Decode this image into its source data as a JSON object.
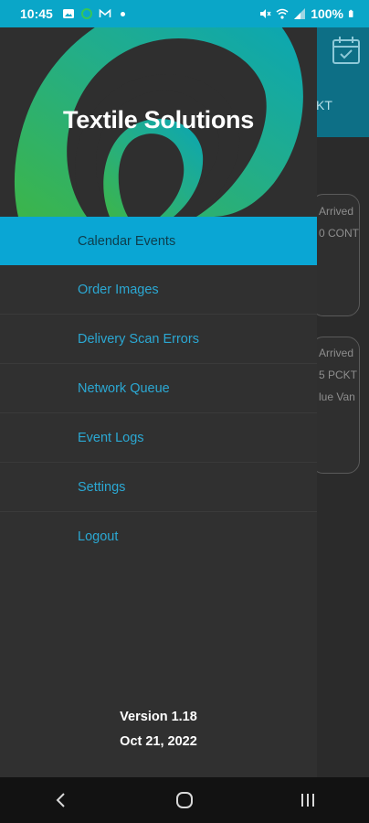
{
  "status_bar": {
    "time": "10:45",
    "battery": "100%",
    "icons_left": [
      "photo-icon",
      "chat-icon",
      "mail-icon",
      "dot"
    ],
    "icons_right": [
      "mute-icon",
      "wifi-icon",
      "signal-icon",
      "battery-icon"
    ]
  },
  "background_app": {
    "tab_fragment": "KT",
    "cards": [
      {
        "lines": [
          "Arrived",
          "0 CONT"
        ]
      },
      {
        "lines": [
          "Arrived",
          "5 PCKT",
          "lue Van"
        ]
      }
    ]
  },
  "drawer": {
    "title": "Textile Solutions",
    "menu": [
      {
        "label": "Calendar Events",
        "active": true
      },
      {
        "label": "Order Images",
        "active": false
      },
      {
        "label": "Delivery Scan Errors",
        "active": false
      },
      {
        "label": "Network Queue",
        "active": false
      },
      {
        "label": "Event Logs",
        "active": false
      },
      {
        "label": "Settings",
        "active": false
      },
      {
        "label": "Logout",
        "active": false
      }
    ],
    "version": "Version 1.18",
    "date": "Oct 21, 2022"
  },
  "colors": {
    "accent": "#0aa6d4",
    "status_bar": "#0aa6c8",
    "toolbar": "#0d6f86",
    "menu_text": "#2ba8d3",
    "drawer_bg": "#303030",
    "logo_green": "#3cb54a",
    "logo_teal": "#0aa6b5"
  },
  "nav": {
    "buttons": [
      "back-icon",
      "home-icon",
      "recents-icon"
    ]
  }
}
